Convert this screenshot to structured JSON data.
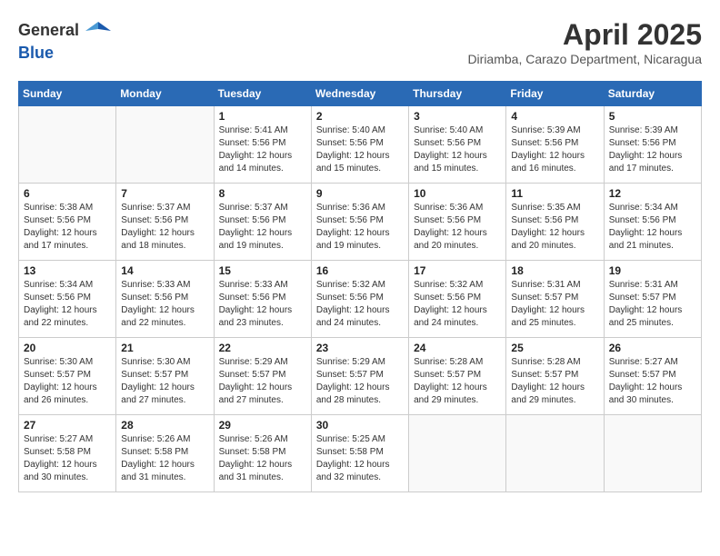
{
  "header": {
    "logo_line1": "General",
    "logo_line2": "Blue",
    "month_year": "April 2025",
    "location": "Diriamba, Carazo Department, Nicaragua"
  },
  "weekdays": [
    "Sunday",
    "Monday",
    "Tuesday",
    "Wednesday",
    "Thursday",
    "Friday",
    "Saturday"
  ],
  "weeks": [
    [
      {
        "day": "",
        "info": ""
      },
      {
        "day": "",
        "info": ""
      },
      {
        "day": "1",
        "info": "Sunrise: 5:41 AM\nSunset: 5:56 PM\nDaylight: 12 hours\nand 14 minutes."
      },
      {
        "day": "2",
        "info": "Sunrise: 5:40 AM\nSunset: 5:56 PM\nDaylight: 12 hours\nand 15 minutes."
      },
      {
        "day": "3",
        "info": "Sunrise: 5:40 AM\nSunset: 5:56 PM\nDaylight: 12 hours\nand 15 minutes."
      },
      {
        "day": "4",
        "info": "Sunrise: 5:39 AM\nSunset: 5:56 PM\nDaylight: 12 hours\nand 16 minutes."
      },
      {
        "day": "5",
        "info": "Sunrise: 5:39 AM\nSunset: 5:56 PM\nDaylight: 12 hours\nand 17 minutes."
      }
    ],
    [
      {
        "day": "6",
        "info": "Sunrise: 5:38 AM\nSunset: 5:56 PM\nDaylight: 12 hours\nand 17 minutes."
      },
      {
        "day": "7",
        "info": "Sunrise: 5:37 AM\nSunset: 5:56 PM\nDaylight: 12 hours\nand 18 minutes."
      },
      {
        "day": "8",
        "info": "Sunrise: 5:37 AM\nSunset: 5:56 PM\nDaylight: 12 hours\nand 19 minutes."
      },
      {
        "day": "9",
        "info": "Sunrise: 5:36 AM\nSunset: 5:56 PM\nDaylight: 12 hours\nand 19 minutes."
      },
      {
        "day": "10",
        "info": "Sunrise: 5:36 AM\nSunset: 5:56 PM\nDaylight: 12 hours\nand 20 minutes."
      },
      {
        "day": "11",
        "info": "Sunrise: 5:35 AM\nSunset: 5:56 PM\nDaylight: 12 hours\nand 20 minutes."
      },
      {
        "day": "12",
        "info": "Sunrise: 5:34 AM\nSunset: 5:56 PM\nDaylight: 12 hours\nand 21 minutes."
      }
    ],
    [
      {
        "day": "13",
        "info": "Sunrise: 5:34 AM\nSunset: 5:56 PM\nDaylight: 12 hours\nand 22 minutes."
      },
      {
        "day": "14",
        "info": "Sunrise: 5:33 AM\nSunset: 5:56 PM\nDaylight: 12 hours\nand 22 minutes."
      },
      {
        "day": "15",
        "info": "Sunrise: 5:33 AM\nSunset: 5:56 PM\nDaylight: 12 hours\nand 23 minutes."
      },
      {
        "day": "16",
        "info": "Sunrise: 5:32 AM\nSunset: 5:56 PM\nDaylight: 12 hours\nand 24 minutes."
      },
      {
        "day": "17",
        "info": "Sunrise: 5:32 AM\nSunset: 5:56 PM\nDaylight: 12 hours\nand 24 minutes."
      },
      {
        "day": "18",
        "info": "Sunrise: 5:31 AM\nSunset: 5:57 PM\nDaylight: 12 hours\nand 25 minutes."
      },
      {
        "day": "19",
        "info": "Sunrise: 5:31 AM\nSunset: 5:57 PM\nDaylight: 12 hours\nand 25 minutes."
      }
    ],
    [
      {
        "day": "20",
        "info": "Sunrise: 5:30 AM\nSunset: 5:57 PM\nDaylight: 12 hours\nand 26 minutes."
      },
      {
        "day": "21",
        "info": "Sunrise: 5:30 AM\nSunset: 5:57 PM\nDaylight: 12 hours\nand 27 minutes."
      },
      {
        "day": "22",
        "info": "Sunrise: 5:29 AM\nSunset: 5:57 PM\nDaylight: 12 hours\nand 27 minutes."
      },
      {
        "day": "23",
        "info": "Sunrise: 5:29 AM\nSunset: 5:57 PM\nDaylight: 12 hours\nand 28 minutes."
      },
      {
        "day": "24",
        "info": "Sunrise: 5:28 AM\nSunset: 5:57 PM\nDaylight: 12 hours\nand 29 minutes."
      },
      {
        "day": "25",
        "info": "Sunrise: 5:28 AM\nSunset: 5:57 PM\nDaylight: 12 hours\nand 29 minutes."
      },
      {
        "day": "26",
        "info": "Sunrise: 5:27 AM\nSunset: 5:57 PM\nDaylight: 12 hours\nand 30 minutes."
      }
    ],
    [
      {
        "day": "27",
        "info": "Sunrise: 5:27 AM\nSunset: 5:58 PM\nDaylight: 12 hours\nand 30 minutes."
      },
      {
        "day": "28",
        "info": "Sunrise: 5:26 AM\nSunset: 5:58 PM\nDaylight: 12 hours\nand 31 minutes."
      },
      {
        "day": "29",
        "info": "Sunrise: 5:26 AM\nSunset: 5:58 PM\nDaylight: 12 hours\nand 31 minutes."
      },
      {
        "day": "30",
        "info": "Sunrise: 5:25 AM\nSunset: 5:58 PM\nDaylight: 12 hours\nand 32 minutes."
      },
      {
        "day": "",
        "info": ""
      },
      {
        "day": "",
        "info": ""
      },
      {
        "day": "",
        "info": ""
      }
    ]
  ]
}
